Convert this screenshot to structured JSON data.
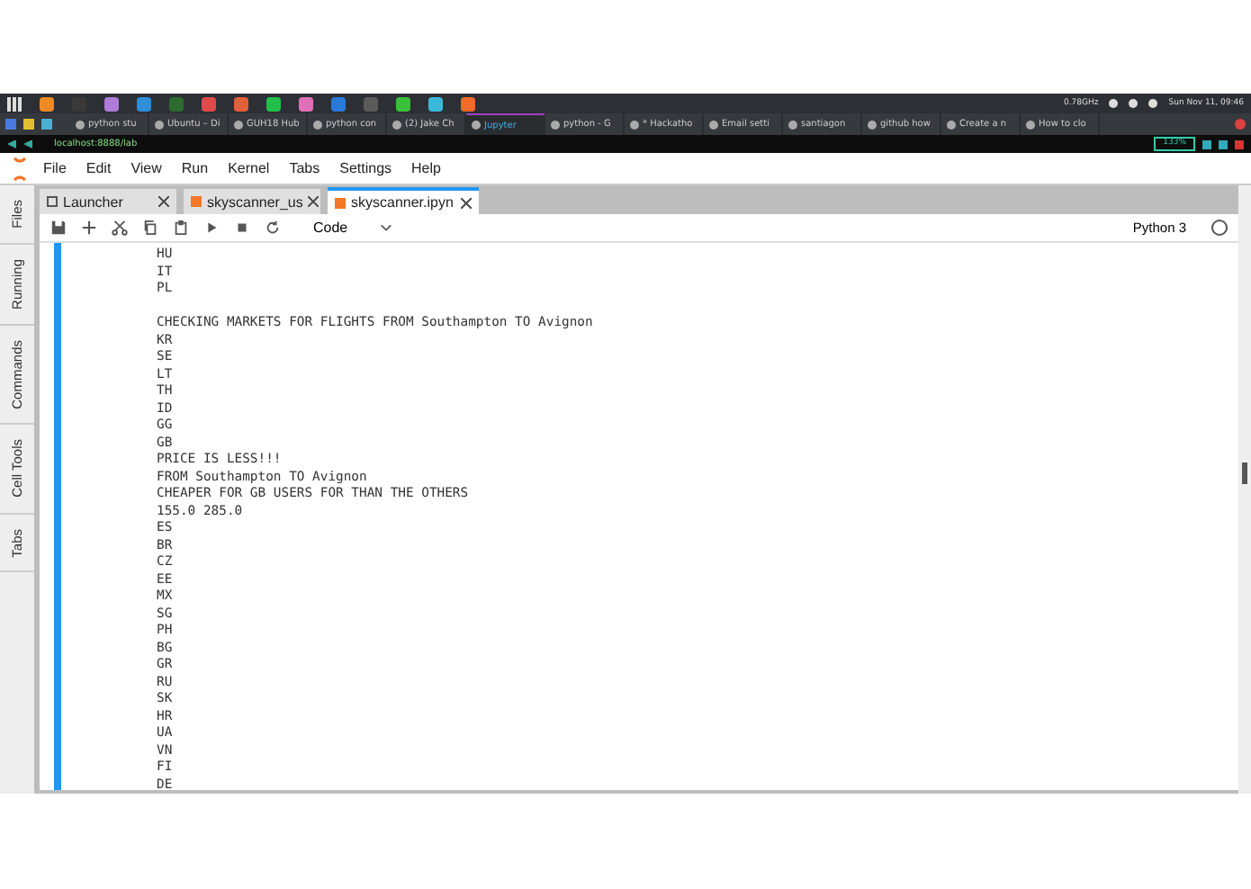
{
  "os_panel": {
    "launchers": [
      {
        "color": "#f08a24"
      },
      {
        "color": "#3a3a3a"
      },
      {
        "color": "#b07ad8"
      },
      {
        "color": "#2f8fd8"
      },
      {
        "color": "#2e6b2e"
      },
      {
        "color": "#e04a4a"
      },
      {
        "color": "#e0603a"
      },
      {
        "color": "#22c04a"
      },
      {
        "color": "#e070b8"
      },
      {
        "color": "#2a7ad8"
      },
      {
        "color": "#5a5a5a"
      },
      {
        "color": "#3ac03a"
      },
      {
        "color": "#3ab8d8"
      },
      {
        "color": "#f06a2a"
      }
    ],
    "tray": {
      "cpu": "0.78GHz",
      "clock": "Sun Nov 11, 09:46"
    }
  },
  "browser": {
    "tabs": [
      {
        "label": "python stu",
        "selected": false
      },
      {
        "label": "Ubuntu – Di",
        "selected": false
      },
      {
        "label": "GUH18 Hub",
        "selected": false
      },
      {
        "label": "python con",
        "selected": false
      },
      {
        "label": "(2) Jake Ch",
        "selected": false
      },
      {
        "label": "Jupyter",
        "selected": true
      },
      {
        "label": "python - G",
        "selected": false
      },
      {
        "label": "* Hackatho",
        "selected": false
      },
      {
        "label": "Email setti",
        "selected": false
      },
      {
        "label": "santiagon",
        "selected": false
      },
      {
        "label": "github how",
        "selected": false
      },
      {
        "label": "Create a n",
        "selected": false
      },
      {
        "label": "How to clo",
        "selected": false
      }
    ],
    "url": "localhost:8888/lab",
    "zoom": "133%"
  },
  "jupyter": {
    "menu": [
      "File",
      "Edit",
      "View",
      "Run",
      "Kernel",
      "Tabs",
      "Settings",
      "Help"
    ],
    "sidebar_tabs": [
      "Files",
      "Running",
      "Commands",
      "Cell Tools",
      "Tabs"
    ],
    "tabs": [
      {
        "label": "Launcher",
        "kind": "launcher",
        "selected": false
      },
      {
        "label": "skyscanner_us",
        "kind": "notebook",
        "selected": false
      },
      {
        "label": "skyscanner.ipyn",
        "kind": "notebook",
        "selected": true
      }
    ],
    "cell_type": "Code",
    "kernel": "Python 3",
    "output_blocks": [
      [
        "HU",
        "IT",
        "PL"
      ],
      [
        "CHECKING MARKETS FOR FLIGHTS FROM Southampton TO Avignon",
        "KR",
        "SE",
        "LT",
        "TH",
        "ID",
        "GG",
        "GB",
        "PRICE IS LESS!!!",
        "FROM Southampton TO Avignon",
        "CHEAPER FOR GB USERS FOR THAN THE OTHERS",
        "155.0 285.0",
        "ES",
        "BR",
        "CZ",
        "EE",
        "MX",
        "SG",
        "PH",
        "BG",
        "GR",
        "RU",
        "SK",
        "HR",
        "UA",
        "VN",
        "FI",
        "DE"
      ]
    ]
  }
}
